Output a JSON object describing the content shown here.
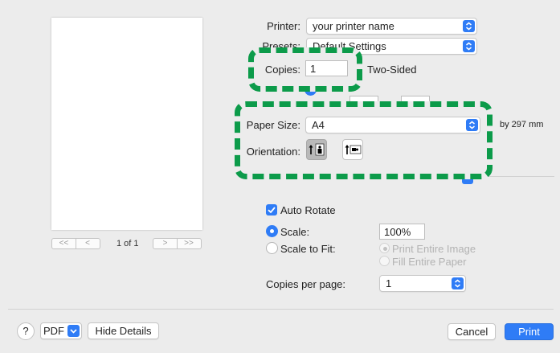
{
  "preview": {
    "page_indicator": "1 of 1",
    "nav_first": "<<",
    "nav_prev": "<",
    "nav_next": ">",
    "nav_last": ">>"
  },
  "printer": {
    "label": "Printer:",
    "value": "your printer name"
  },
  "presets": {
    "label": "Presets:",
    "value": "Default Settings"
  },
  "copies": {
    "label": "Copies:",
    "value": "1",
    "two_sided_label": "Two-Sided"
  },
  "paper_size": {
    "label": "Paper Size:",
    "value": "A4",
    "dimension_text": "by 297 mm"
  },
  "orientation": {
    "label": "Orientation:"
  },
  "auto_rotate": {
    "label": "Auto Rotate",
    "checked": true
  },
  "scale": {
    "label": "Scale:",
    "value": "100%",
    "selected": true
  },
  "scale_to_fit": {
    "label": "Scale to Fit:",
    "options": [
      "Print Entire Image",
      "Fill Entire Paper"
    ]
  },
  "copies_per_page": {
    "label": "Copies per page:",
    "value": "1"
  },
  "footer": {
    "help_label": "?",
    "pdf_label": "PDF",
    "hide_details_label": "Hide Details",
    "cancel_label": "Cancel",
    "print_label": "Print"
  },
  "colors": {
    "accent": "#2f7cf6",
    "highlight": "#0c9b4a"
  }
}
